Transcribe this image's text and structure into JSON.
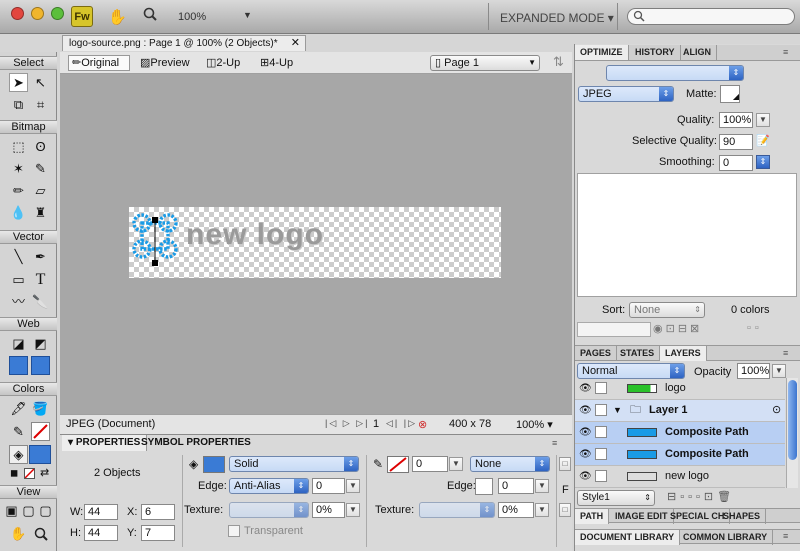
{
  "app": {
    "logo": "Fw",
    "zoom": "100%",
    "mode": "EXPANDED MODE"
  },
  "tools": {
    "sections": [
      "Select",
      "Bitmap",
      "Vector",
      "Web",
      "Colors",
      "View"
    ]
  },
  "document": {
    "tab_title": "logo-source.png : Page 1 @ 100% (2 Objects)*",
    "views": [
      "Original",
      "Preview",
      "2-Up",
      "4-Up"
    ],
    "page": "Page 1",
    "artwork_text": "new logo",
    "status": {
      "format": "JPEG (Document)",
      "frame": "1",
      "size": "400 x 78",
      "zoom": "100%"
    }
  },
  "properties": {
    "tabs": [
      "PROPERTIES",
      "SYMBOL PROPERTIES"
    ],
    "object_count": "2 Objects",
    "fill_type": "Solid",
    "edge_label": "Edge:",
    "edge_value": "Anti-Alias",
    "edge_amount": "0",
    "texture_label": "Texture:",
    "texture_pct": "0%",
    "transparent_label": "Transparent",
    "stroke_size": "0",
    "stroke_type": "None",
    "stroke_edge_label": "Edge:",
    "stroke_edge_value": "0",
    "stroke_texture_label": "Texture:",
    "stroke_texture_pct": "0%",
    "w_label": "W:",
    "w": "44",
    "h_label": "H:",
    "h": "44",
    "x_label": "X:",
    "x": "6",
    "y_label": "Y:",
    "y": "7",
    "f_label": "F"
  },
  "optimize": {
    "tabs": [
      "OPTIMIZE",
      "HISTORY",
      "ALIGN"
    ],
    "format": "JPEG",
    "matte_label": "Matte:",
    "quality_label": "Quality:",
    "quality": "100%",
    "selective_label": "Selective Quality:",
    "selective": "90",
    "smoothing_label": "Smoothing:",
    "smoothing": "0",
    "sort_label": "Sort:",
    "sort": "None",
    "colors": "0 colors"
  },
  "layers": {
    "tabs": [
      "PAGES",
      "STATES",
      "LAYERS"
    ],
    "blend": "Normal",
    "opacity_label": "Opacity",
    "opacity": "100%",
    "rows": [
      "logo",
      "Layer 1",
      "Composite Path",
      "Composite Path",
      "new logo"
    ],
    "style": "Style1"
  },
  "bottom_tabs": [
    "PATH",
    "IMAGE EDIT",
    "SPECIAL CH",
    "SHAPES"
  ],
  "library_tabs": [
    "DOCUMENT LIBRARY",
    "COMMON LIBRARY"
  ],
  "colors": {
    "accent_blue": "#1a9be6",
    "selection": "#b8cff3",
    "logo_gray": "#9a9a9a"
  }
}
